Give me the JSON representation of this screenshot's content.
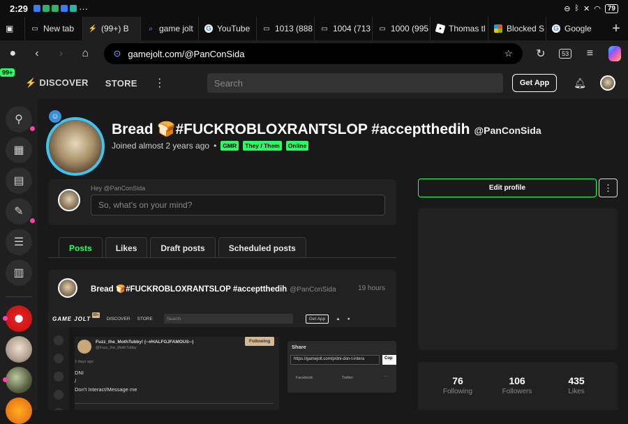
{
  "status": {
    "time": "2:29",
    "more": "···",
    "battery": "79"
  },
  "tabs": [
    {
      "label": "New tab",
      "icon": "page-icon"
    },
    {
      "label": "(99+) B",
      "icon": "gamejolt-icon",
      "active": true
    },
    {
      "label": "game jolt",
      "icon": "search-icon"
    },
    {
      "label": "YouTube",
      "icon": "google-icon"
    },
    {
      "label": "1013 (888",
      "icon": "page-icon"
    },
    {
      "label": "1004 (713",
      "icon": "page-icon"
    },
    {
      "label": "1000 (995",
      "icon": "page-icon"
    },
    {
      "label": "Thomas tl",
      "icon": "roblox-icon"
    },
    {
      "label": "Blocked S",
      "icon": "microsoft-icon"
    },
    {
      "label": "Google",
      "icon": "google-icon"
    }
  ],
  "address": {
    "url": "gamejolt.com/@PanConSida",
    "tab_count": "53"
  },
  "gj": {
    "notif_badge": "99+",
    "discover": "DISCOVER",
    "store": "STORE",
    "search_placeholder": "Search",
    "get_app": "Get App"
  },
  "profile": {
    "name": "Bread 🍞#FUCKROBLOXRANTSLOP #acceptthedih",
    "handle": "@PanConSida",
    "joined": "Joined almost 2 years ago",
    "tags": [
      "GMR",
      "They / Them",
      "Online"
    ]
  },
  "compose": {
    "hey": "Hey @PanConSida",
    "placeholder": "So, what's on your mind?"
  },
  "profile_tabs": [
    "Posts",
    "Likes",
    "Draft posts",
    "Scheduled posts"
  ],
  "post": {
    "author": "Bread 🍞#FUCKROBLOXRANTSLOP #acceptthedih",
    "handle": "@PanConSida",
    "time": "19 hours",
    "shot": {
      "logo": "GAME JOLT",
      "badge": "99+",
      "discover": "DISCOVER",
      "store": "STORE",
      "search": "Search",
      "get_app": "Get App",
      "user": "Fuzz_the_MothTubby! (--#HALFGJFAMOUS--)",
      "user_handle": "@Fuzz_the_MothTubby",
      "follow": "Following",
      "ago": "2 days ago",
      "line1": "DNI",
      "line2": "/",
      "line3": "Don't Interact/Message me",
      "share_title": "Share",
      "share_url": "https://gamejolt.com/p/dni-don-t-intera",
      "copy": "Cop",
      "facebook": "Facebook",
      "twitter": "Twitter",
      "more": "···"
    }
  },
  "sidebar_actions": {
    "edit_profile": "Edit profile",
    "more": "⋮"
  },
  "stats": [
    {
      "value": "76",
      "label": "Following"
    },
    {
      "value": "106",
      "label": "Followers"
    },
    {
      "value": "435",
      "label": "Likes"
    }
  ],
  "colors": {
    "accent": "#2ff866",
    "notify": "#ff3fac",
    "avatar_ring": "#3fc4f0"
  }
}
